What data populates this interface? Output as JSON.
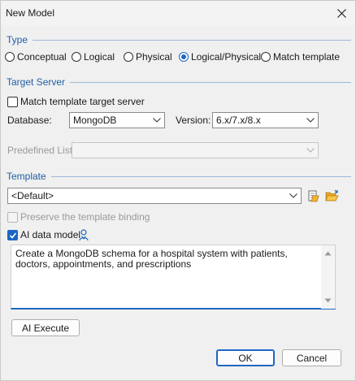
{
  "window": {
    "title": "New Model"
  },
  "type_section": {
    "label": "Type",
    "options": [
      {
        "label": "Conceptual",
        "selected": false
      },
      {
        "label": "Logical",
        "selected": false
      },
      {
        "label": "Physical",
        "selected": false
      },
      {
        "label": "Logical/Physical",
        "selected": true
      },
      {
        "label": "Match template",
        "selected": false
      }
    ]
  },
  "target_server": {
    "label": "Target Server",
    "match_template_label": "Match template target server",
    "match_template_checked": false,
    "database_label": "Database:",
    "database_value": "MongoDB",
    "version_label": "Version:",
    "version_value": "6.x/7.x/8.x",
    "predefined_label": "Predefined List:",
    "predefined_value": ""
  },
  "template_section": {
    "label": "Template",
    "template_value": "<Default>",
    "preserve_label": "Preserve the template binding",
    "ai_label": "AI data model",
    "ai_checked": true,
    "prompt_text": "Create a MongoDB schema for a hospital system with patients, doctors, appointments, and prescriptions",
    "ai_execute_label": "AI Execute"
  },
  "footer": {
    "ok_label": "OK",
    "cancel_label": "Cancel"
  },
  "colors": {
    "accent": "#1d67c2",
    "section_label": "#1f5fa6"
  }
}
